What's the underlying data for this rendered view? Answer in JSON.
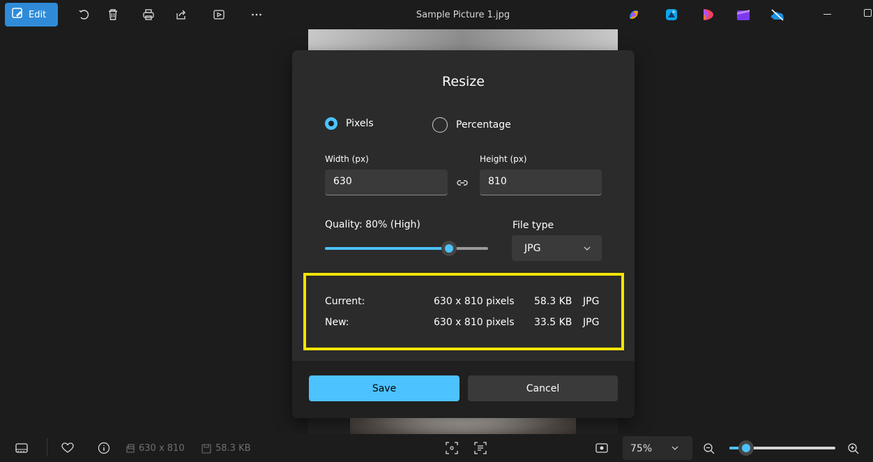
{
  "app": {
    "title": "Sample Picture 1.jpg",
    "edit_label": "Edit"
  },
  "toolbar": {
    "icons": [
      "rotate-icon",
      "delete-icon",
      "print-icon",
      "share-icon",
      "slideshow-icon",
      "more-icon"
    ]
  },
  "dialog": {
    "title": "Resize",
    "radio_pixels": "Pixels",
    "radio_percentage": "Percentage",
    "selected_mode": "Pixels",
    "width_label": "Width (px)",
    "height_label": "Height (px)",
    "width_value": "630",
    "height_value": "810",
    "quality_label": "Quality: 80% (High)",
    "quality_value": 0.8,
    "file_type_label": "File type",
    "file_type_value": "JPG",
    "current_label": "Current:",
    "current_dims": "630 x 810 pixels",
    "current_size": "58.3 KB",
    "current_type": "JPG",
    "new_label": "New:",
    "new_dims": "630 x 810 pixels",
    "new_size": "33.5 KB",
    "new_type": "JPG",
    "save_label": "Save",
    "cancel_label": "Cancel"
  },
  "statusbar": {
    "dimensions": "630 x 810",
    "filesize": "58.3 KB",
    "zoom": "75%",
    "zoom_level": 0.1
  },
  "colors": {
    "accent": "#4cc2ff",
    "edit_button": "#2f8bd8",
    "highlight": "#f5e400"
  }
}
